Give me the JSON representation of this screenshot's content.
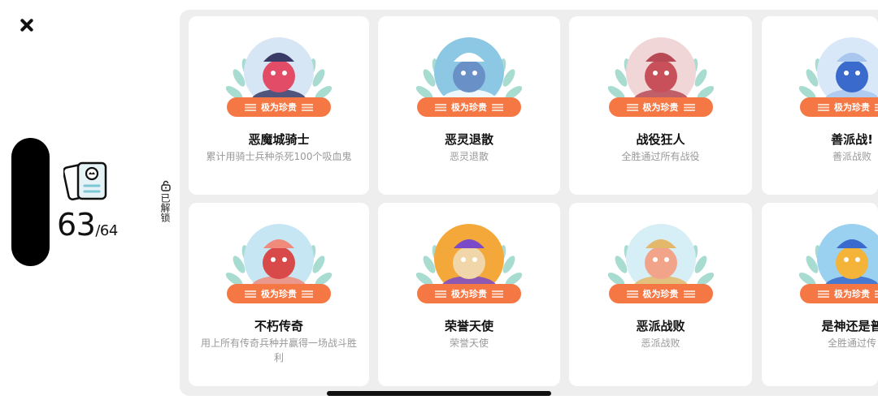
{
  "progress": {
    "unlocked": "63",
    "total": "/64"
  },
  "sidebar": {
    "filter_label": "已解锁"
  },
  "colors": {
    "ribbon": "#f57744",
    "panel": "#eeeeee"
  },
  "achievements": [
    {
      "title": "恶魔城骑士",
      "desc": "累计用骑士兵种杀死100个吸血鬼",
      "rarity": "极为珍贵",
      "palette": [
        "#e24c66",
        "#3a3a66",
        "#d6e6f5"
      ]
    },
    {
      "title": "恶灵退散",
      "desc": "恶灵退散",
      "rarity": "极为珍贵",
      "palette": [
        "#6a90c8",
        "#ffffff",
        "#8cc8e4"
      ]
    },
    {
      "title": "战役狂人",
      "desc": "全胜通过所有战役",
      "rarity": "极为珍贵",
      "palette": [
        "#c8505a",
        "#b84a56",
        "#f0d6d6"
      ]
    },
    {
      "title": "善派战!",
      "desc": "善派战败",
      "rarity": "极为珍贵",
      "palette": [
        "#3a6acb",
        "#a8c6ee",
        "#d8e8f8"
      ]
    },
    {
      "title": "不朽传奇",
      "desc": "用上所有传奇兵种并赢得一场战斗胜利",
      "rarity": "极为珍贵",
      "palette": [
        "#d84a4a",
        "#f08a7a",
        "#c6e6f4"
      ]
    },
    {
      "title": "荣誉天使",
      "desc": "荣誉天使",
      "rarity": "极为珍贵",
      "palette": [
        "#f0d6a8",
        "#7a4ac8",
        "#f4a83a"
      ]
    },
    {
      "title": "恶派战败",
      "desc": "恶派战败",
      "rarity": "极为珍贵",
      "palette": [
        "#f2a48a",
        "#e4b86a",
        "#d6eef6"
      ]
    },
    {
      "title": "是神还是普",
      "desc": "全胜通过传",
      "rarity": "极为珍贵",
      "palette": [
        "#f4b43a",
        "#3a6acb",
        "#9ad0f0"
      ]
    }
  ]
}
